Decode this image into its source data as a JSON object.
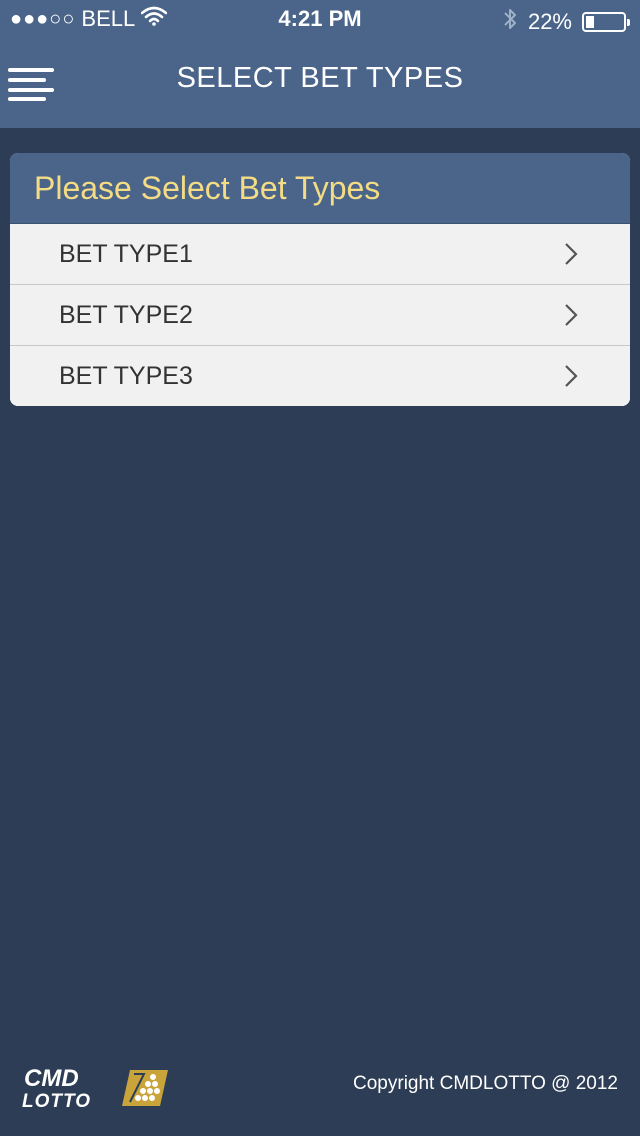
{
  "status_bar": {
    "signal": "●●●○○",
    "carrier": "BELL",
    "time": "4:21 PM",
    "battery_percent": "22%",
    "battery_level": 0.22,
    "icons": [
      "wifi-icon",
      "bluetooth-icon",
      "battery-icon"
    ]
  },
  "nav": {
    "title": "SELECT BET TYPES",
    "menu_icon": "hamburger-menu-icon"
  },
  "card": {
    "header": "Please Select Bet Types",
    "items": [
      {
        "label": "BET TYPE1",
        "icon": "chevron-right-icon"
      },
      {
        "label": "BET TYPE2",
        "icon": "chevron-right-icon"
      },
      {
        "label": "BET TYPE3",
        "icon": "chevron-right-icon"
      }
    ]
  },
  "footer": {
    "logo_line1": "CMD",
    "logo_line2": "LOTTO",
    "copyright": "Copyright CMDLOTTO @ 2012"
  },
  "colors": {
    "background": "#2c3d55",
    "header_bar": "#4a6589",
    "card_header_text": "#f4dc85",
    "row_background": "#f1f1f1",
    "logo_accent": "#c9a43a"
  }
}
